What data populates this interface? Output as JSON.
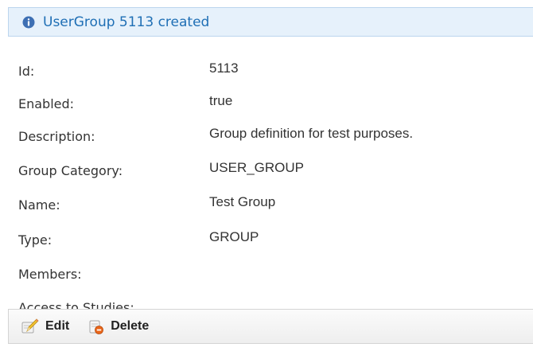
{
  "message": {
    "text": "UserGroup 5113 created",
    "icon": "info-icon"
  },
  "fields": [
    {
      "label": "Id:",
      "value": "5113"
    },
    {
      "label": "Enabled:",
      "value": "true"
    },
    {
      "label": "Description:",
      "value": "Group definition for test purposes."
    },
    {
      "label": "Group Category:",
      "value": "USER_GROUP"
    },
    {
      "label": "Name:",
      "value": "Test Group"
    },
    {
      "label": "Type:",
      "value": "GROUP"
    },
    {
      "label": "Members:",
      "value": ""
    },
    {
      "label": "Access to Studies:",
      "value": ""
    }
  ],
  "toolbar": {
    "edit_label": "Edit",
    "edit_icon": "edit-pencil-icon",
    "delete_label": "Delete",
    "delete_icon": "delete-icon"
  },
  "colors": {
    "message_bg": "#e6f1fb",
    "message_text": "#1f6fb5",
    "text": "#333333"
  }
}
